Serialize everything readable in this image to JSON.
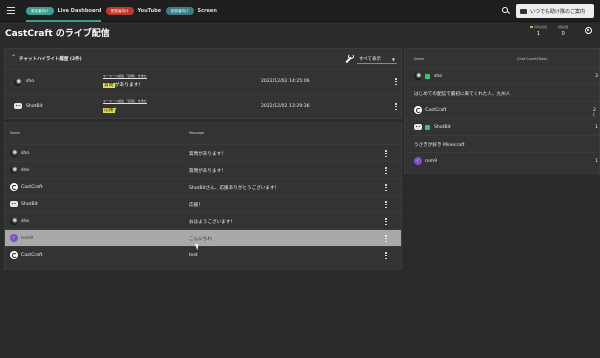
{
  "topbar": {
    "tabs": [
      {
        "badge": "参加者向け",
        "badge_color": "#3f9e8f",
        "label": "Live Dashboard",
        "active": true
      },
      {
        "badge": "配信者向け",
        "badge_color": "#c0392b",
        "label": "YouTube",
        "active": false
      },
      {
        "badge": "配信者向け",
        "badge_color": "#3a7d86",
        "label": "Screen",
        "active": false
      }
    ],
    "guide_button": "いつでも助け隊のご案内"
  },
  "header": {
    "title": "CastCraft のライブ配信",
    "stats": [
      {
        "label": "同時接続数",
        "value": "1"
      },
      {
        "label": "視聴者数",
        "value": "0"
      }
    ]
  },
  "highlights": {
    "title": "チャットハイライト履歴 (2件)",
    "filter": "すべて表示",
    "rows": [
      {
        "name": "sho",
        "avatar": "dark",
        "tag": "キーワード検出 「質問」 を含む",
        "marked": "質問",
        "rest": "があります！",
        "time": "2022/12/02 14:25:06"
      },
      {
        "name": "ShotBit",
        "avatar": "bot",
        "tag": "キーワード検出 「応援」 を含む",
        "marked": "応援",
        "rest": "！",
        "time": "2022/12/02 13:29:36"
      }
    ]
  },
  "chat": {
    "col_name": "Name",
    "col_message": "Message",
    "rows": [
      {
        "name": "sho",
        "avatar": "dark",
        "message": "質問があります！"
      },
      {
        "name": "sho",
        "avatar": "dark",
        "message": "質問があります！"
      },
      {
        "name": "CastCraft",
        "avatar": "cc",
        "message": "ShotBitさん、応援ありがとうございます！"
      },
      {
        "name": "ShotBit",
        "avatar": "bot",
        "message": "応援！"
      },
      {
        "name": "sho",
        "avatar": "dark",
        "message": "おはようございます！"
      },
      {
        "name": "rom9",
        "avatar": "r",
        "message": "こんにちわ",
        "selected": true
      },
      {
        "name": "CastCraft",
        "avatar": "cc",
        "message": "test"
      }
    ]
  },
  "stats_panel": {
    "col_name": "Name",
    "col_count": "Chat Count(Total)",
    "rows": [
      {
        "type": "user",
        "name": "sho",
        "avatar": "dark",
        "badge": true,
        "count": "3"
      },
      {
        "type": "text",
        "text": "はじめての配信で最初に来てくれた人、九州人"
      },
      {
        "type": "user",
        "name": "CastCraft",
        "avatar": "cc",
        "badge": false,
        "count": "2 ("
      },
      {
        "type": "user",
        "name": "ShotBit",
        "avatar": "bot",
        "badge": true,
        "count": "1"
      },
      {
        "type": "text",
        "text": "うさぎが好き Minecraft"
      },
      {
        "type": "user",
        "name": "rom9",
        "avatar": "r",
        "badge": false,
        "count": "1"
      }
    ]
  }
}
